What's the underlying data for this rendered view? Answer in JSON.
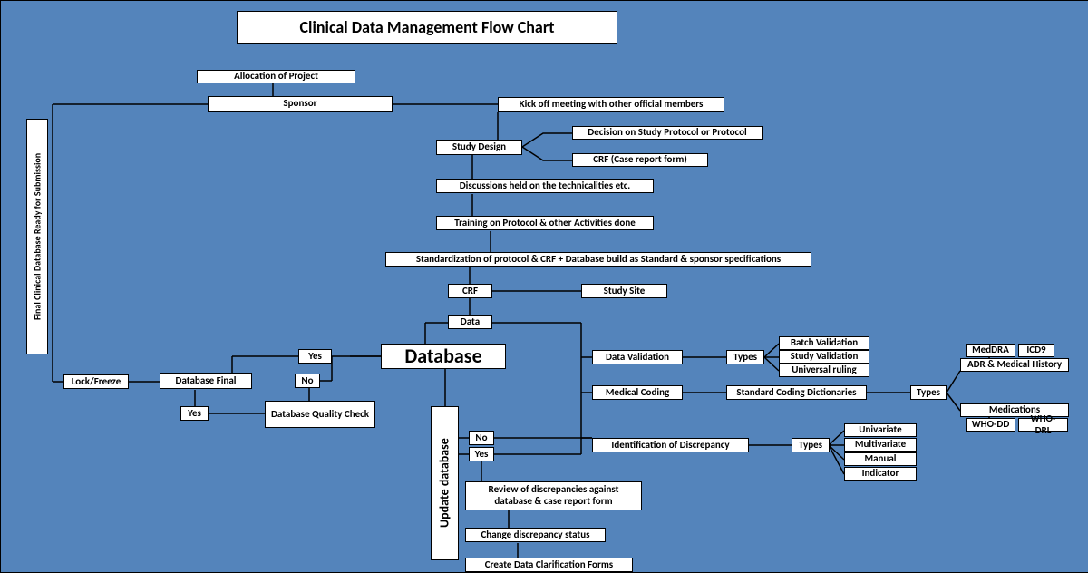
{
  "title": "Clinical Data Management Flow Chart",
  "nodes": {
    "alloc": "Allocation of Project",
    "sponsor": "Sponsor",
    "kickoff": "Kick off meeting with other official members",
    "study_design": "Study Design",
    "decision_protocol": "Decision on Study Protocol or Protocol",
    "crf_form": "CRF (Case report form)",
    "discussions": "Discussions held on the technicalities etc.",
    "training": "Training on Protocol & other Activities done",
    "standardization": "Standardization of protocol & CRF + Database build as Standard & sponsor specifications",
    "crf": "CRF",
    "study_site": "Study Site",
    "data": "Data",
    "database": "Database",
    "update_db": "Update database",
    "data_validation": "Data Validation",
    "types1": "Types",
    "batch_val": "Batch Validation",
    "study_val": "Study Validation",
    "universal": "Universal ruling",
    "medical_coding": "Medical Coding",
    "std_dict": "Standard Coding Dictionaries",
    "types2": "Types",
    "meddra": "MedDRA",
    "icd9": "ICD9",
    "adr": "ADR & Medical History",
    "medications": "Medications",
    "who_dd": "WHO-DD",
    "who_drl": "WHO-DRL",
    "no": "No",
    "yes_disc": "Yes",
    "ident_disc": "Identification of Discrepancy",
    "types3": "Types",
    "univariate": "Univariate",
    "multivariate": "Multivariate",
    "manual": "Manual",
    "indicator": "Indicator",
    "review": "Review of discrepancies against database & case report form",
    "change_status": "Change discrepancy status",
    "create_dcf": "Create Data Clarification Forms",
    "yes_left": "Yes",
    "no_left": "No",
    "db_quality": "Database Quality Check",
    "yes_bl": "Yes",
    "db_final": "Database Final",
    "lock": "Lock/Freeze",
    "final_ready": "Final Clinical Database Ready for Submission"
  }
}
